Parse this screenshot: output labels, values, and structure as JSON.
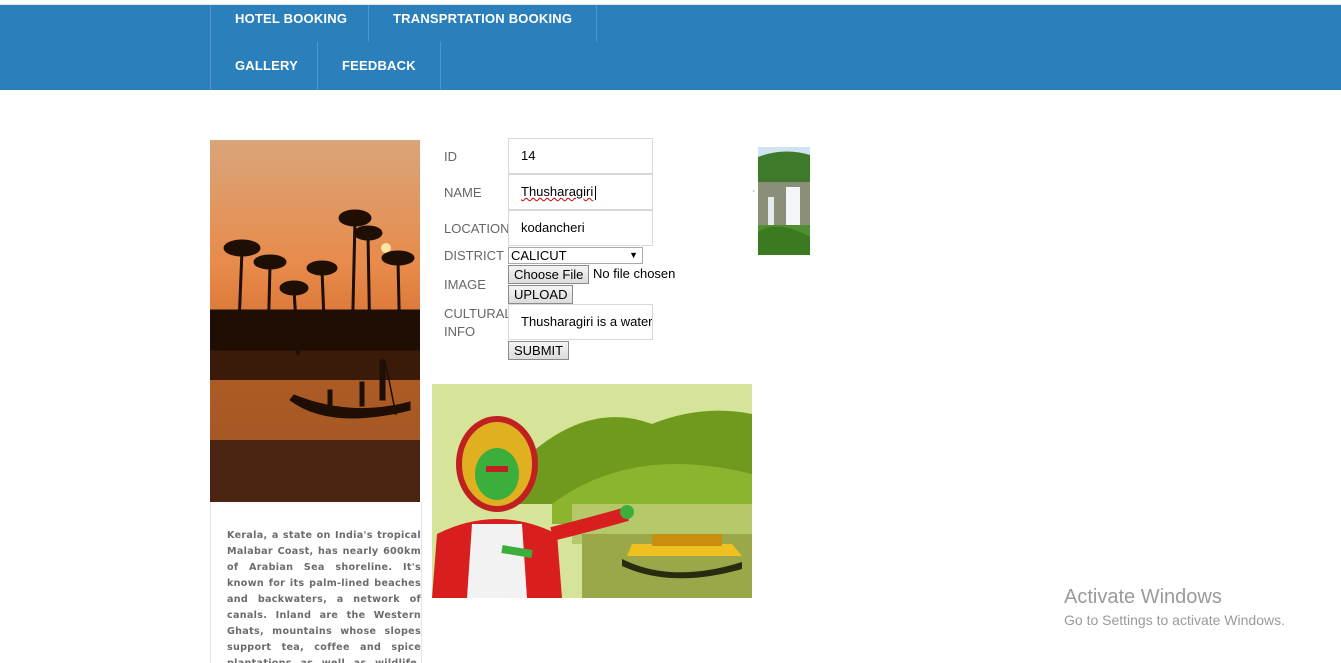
{
  "nav": {
    "hotel_booking": "HOTEL BOOKING",
    "transportation_booking": "TRANSPRTATION BOOKING",
    "gallery": "GALLERY",
    "feedback": "FEEDBACK"
  },
  "form": {
    "id_label": "ID",
    "id_value": "14",
    "name_label": "NAME",
    "name_value": "Thusharagiri",
    "location_label": "LOCATION",
    "location_value": "kodancheri",
    "district_label": "DISTRICT",
    "district_value": "CALICUT",
    "image_label": "IMAGE",
    "choose_file_label": "Choose File",
    "file_status": "No file chosen",
    "upload_label": "UPLOAD",
    "cultural_label_line1": "CULTURAL",
    "cultural_label_line2": "INFO",
    "cultural_value": "Thusharagiri is a waterfall",
    "submit_label": "SUBMIT"
  },
  "sidebar": {
    "description": "Kerala, a state on India's tropical Malabar Coast, has nearly 600km of Arabian Sea shoreline. It's known for its palm-lined beaches and backwaters, a network of canals. Inland are the Western Ghats, mountains whose slopes support tea, coffee and spice plantations as well as wildlife. National parks like"
  },
  "watermark": {
    "title": "Activate Windows",
    "subtitle": "Go to Settings to activate Windows."
  },
  "colors": {
    "navbar": "#2b7fba",
    "nav_text": "#ffffff"
  }
}
